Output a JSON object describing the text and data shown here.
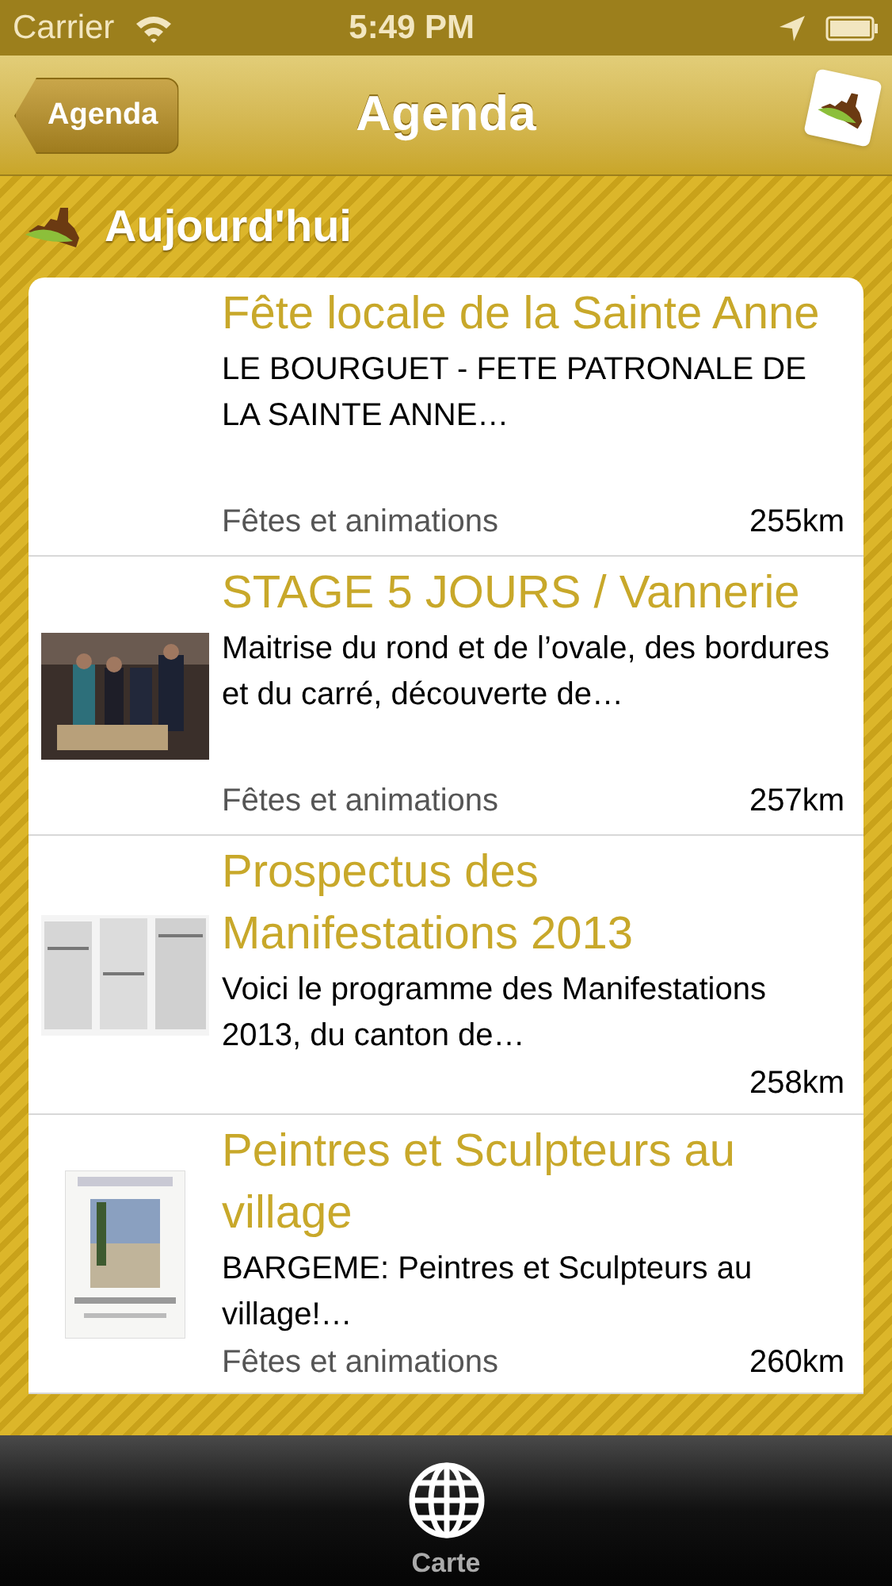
{
  "status_bar": {
    "carrier": "Carrier",
    "time": "5:49 PM"
  },
  "nav_bar": {
    "back": "Agenda",
    "title": "Agenda"
  },
  "section": {
    "title": "Aujourd'hui"
  },
  "events": [
    {
      "title": "Fête locale de la Sainte Anne",
      "description": "LE BOURGUET - FETE PATRONALE DE LA SAINTE ANNE…",
      "category": "Fêtes et animations",
      "distance": "255km"
    },
    {
      "title": "STAGE 5 JOURS / Vannerie",
      "description": "Maitrise du rond et de l’ovale, des bordures et du carré, découverte de…",
      "category": "Fêtes et animations",
      "distance": "257km",
      "kind": "picture"
    },
    {
      "title": "Prospectus des Manifestations 2013",
      "description": "Voici le programme des Manifestations 2013, du canton de…",
      "distance": "258km",
      "kind": "picture"
    },
    {
      "title": "Peintres et Sculpteurs au village",
      "description": "BARGEME: Peintres et Sculpteurs au village!…",
      "category": "Fêtes et animations",
      "distance": "260km",
      "kind": "picture"
    }
  ],
  "tab_bar": {
    "tabs": [
      {
        "label": "Carte",
        "selected": false
      }
    ]
  }
}
